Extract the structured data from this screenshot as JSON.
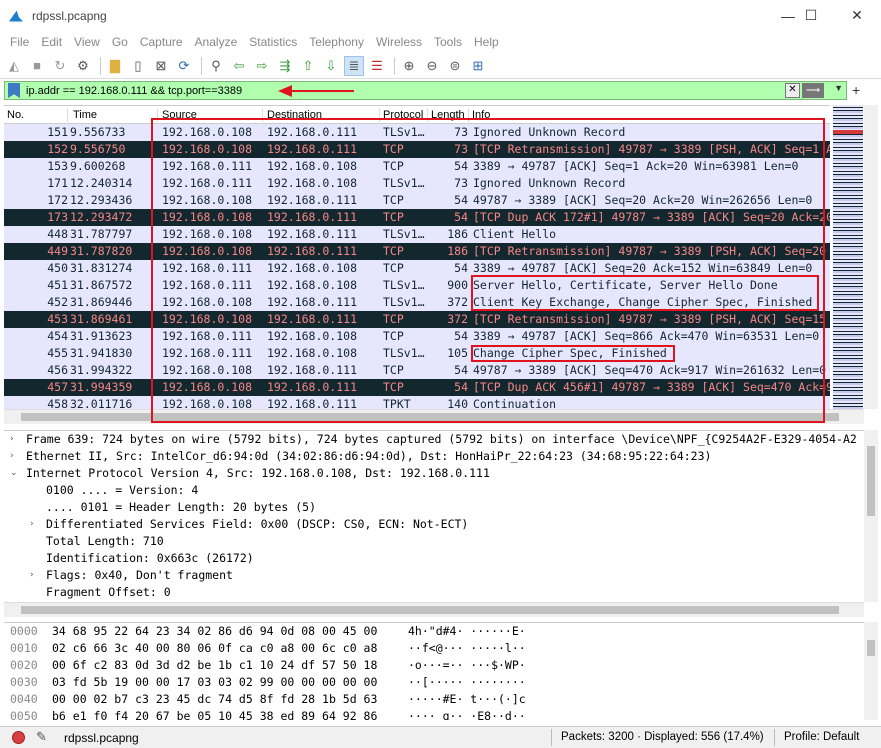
{
  "window": {
    "title": "rdpssl.pcapng",
    "minimize": "—",
    "maximize": "☐",
    "close": "✕"
  },
  "menu": [
    "File",
    "Edit",
    "View",
    "Go",
    "Capture",
    "Analyze",
    "Statistics",
    "Telephony",
    "Wireless",
    "Tools",
    "Help"
  ],
  "filter": {
    "value": "ip.addr == 192.168.0.111 && tcp.port==3389",
    "clear": "✕",
    "apply": "⟶",
    "dropdown": "▼",
    "add": "+"
  },
  "columns": {
    "no": "No.",
    "time": "Time",
    "source": "Source",
    "destination": "Destination",
    "protocol": "Protocol",
    "length": "Length",
    "info": "Info"
  },
  "packets": [
    {
      "no": "151",
      "time": "9.556733",
      "src": "192.168.0.108",
      "dst": "192.168.0.111",
      "proto": "TLSv1…",
      "len": "73",
      "info": "Ignored Unknown Record",
      "style": "normal"
    },
    {
      "no": "152",
      "time": "9.556750",
      "src": "192.168.0.108",
      "dst": "192.168.0.111",
      "proto": "TCP",
      "len": "73",
      "info": "[TCP Retransmission] 49787 → 3389 [PSH, ACK] Seq=1 A",
      "style": "bad"
    },
    {
      "no": "153",
      "time": "9.600268",
      "src": "192.168.0.111",
      "dst": "192.168.0.108",
      "proto": "TCP",
      "len": "54",
      "info": "3389 → 49787 [ACK] Seq=1 Ack=20 Win=63981 Len=0",
      "style": "normal"
    },
    {
      "no": "171",
      "time": "12.240314",
      "src": "192.168.0.111",
      "dst": "192.168.0.108",
      "proto": "TLSv1…",
      "len": "73",
      "info": "Ignored Unknown Record",
      "style": "normal"
    },
    {
      "no": "172",
      "time": "12.293436",
      "src": "192.168.0.108",
      "dst": "192.168.0.111",
      "proto": "TCP",
      "len": "54",
      "info": "49787 → 3389 [ACK] Seq=20 Ack=20 Win=262656 Len=0",
      "style": "normal"
    },
    {
      "no": "173",
      "time": "12.293472",
      "src": "192.168.0.108",
      "dst": "192.168.0.111",
      "proto": "TCP",
      "len": "54",
      "info": "[TCP Dup ACK 172#1] 49787 → 3389 [ACK] Seq=20 Ack=20",
      "style": "bad"
    },
    {
      "no": "448",
      "time": "31.787797",
      "src": "192.168.0.108",
      "dst": "192.168.0.111",
      "proto": "TLSv1…",
      "len": "186",
      "info": "Client Hello",
      "style": "normal"
    },
    {
      "no": "449",
      "time": "31.787820",
      "src": "192.168.0.108",
      "dst": "192.168.0.111",
      "proto": "TCP",
      "len": "186",
      "info": "[TCP Retransmission] 49787 → 3389 [PSH, ACK] Seq=20",
      "style": "bad"
    },
    {
      "no": "450",
      "time": "31.831274",
      "src": "192.168.0.111",
      "dst": "192.168.0.108",
      "proto": "TCP",
      "len": "54",
      "info": "3389 → 49787 [ACK] Seq=20 Ack=152 Win=63849 Len=0",
      "style": "normal"
    },
    {
      "no": "451",
      "time": "31.867572",
      "src": "192.168.0.111",
      "dst": "192.168.0.108",
      "proto": "TLSv1…",
      "len": "900",
      "info": "Server Hello, Certificate, Server Hello Done",
      "style": "normal"
    },
    {
      "no": "452",
      "time": "31.869446",
      "src": "192.168.0.108",
      "dst": "192.168.0.111",
      "proto": "TLSv1…",
      "len": "372",
      "info": "Client Key Exchange, Change Cipher Spec, Finished",
      "style": "normal"
    },
    {
      "no": "453",
      "time": "31.869461",
      "src": "192.168.0.108",
      "dst": "192.168.0.111",
      "proto": "TCP",
      "len": "372",
      "info": "[TCP Retransmission] 49787 → 3389 [PSH, ACK] Seq=15",
      "style": "bad"
    },
    {
      "no": "454",
      "time": "31.913623",
      "src": "192.168.0.111",
      "dst": "192.168.0.108",
      "proto": "TCP",
      "len": "54",
      "info": "3389 → 49787 [ACK] Seq=866 Ack=470 Win=63531 Len=0",
      "style": "normal"
    },
    {
      "no": "455",
      "time": "31.941830",
      "src": "192.168.0.111",
      "dst": "192.168.0.108",
      "proto": "TLSv1…",
      "len": "105",
      "info": "Change Cipher Spec, Finished",
      "style": "normal"
    },
    {
      "no": "456",
      "time": "31.994322",
      "src": "192.168.0.108",
      "dst": "192.168.0.111",
      "proto": "TCP",
      "len": "54",
      "info": "49787 → 3389 [ACK] Seq=470 Ack=917 Win=261632 Len=0",
      "style": "normal"
    },
    {
      "no": "457",
      "time": "31.994359",
      "src": "192.168.0.108",
      "dst": "192.168.0.111",
      "proto": "TCP",
      "len": "54",
      "info": "[TCP Dup ACK 456#1] 49787 → 3389 [ACK] Seq=470 Ack=9",
      "style": "bad"
    },
    {
      "no": "458",
      "time": "32.011716",
      "src": "192.168.0.108",
      "dst": "192.168.0.111",
      "proto": "TPKT",
      "len": "140",
      "info": "Continuation",
      "style": "normal"
    }
  ],
  "details": [
    {
      "twisty": "›",
      "indent": 0,
      "text": "Frame 639: 724 bytes on wire (5792 bits), 724 bytes captured (5792 bits) on interface \\Device\\NPF_{C9254A2F-E329-4054-A2"
    },
    {
      "twisty": "›",
      "indent": 0,
      "text": "Ethernet II, Src: IntelCor_d6:94:0d (34:02:86:d6:94:0d), Dst: HonHaiPr_22:64:23 (34:68:95:22:64:23)"
    },
    {
      "twisty": "⌄",
      "indent": 0,
      "text": "Internet Protocol Version 4, Src: 192.168.0.108, Dst: 192.168.0.111"
    },
    {
      "twisty": "",
      "indent": 1,
      "text": "0100 .... = Version: 4"
    },
    {
      "twisty": "",
      "indent": 1,
      "text": ".... 0101 = Header Length: 20 bytes (5)"
    },
    {
      "twisty": "›",
      "indent": 1,
      "text": "Differentiated Services Field: 0x00 (DSCP: CS0, ECN: Not-ECT)"
    },
    {
      "twisty": "",
      "indent": 1,
      "text": "Total Length: 710"
    },
    {
      "twisty": "",
      "indent": 1,
      "text": "Identification: 0x663c (26172)"
    },
    {
      "twisty": "›",
      "indent": 1,
      "text": "Flags: 0x40, Don't fragment"
    },
    {
      "twisty": "",
      "indent": 1,
      "text": "Fragment Offset: 0"
    }
  ],
  "bytes": [
    {
      "offset": "0000",
      "hex": "34 68 95 22 64 23 34 02  86 d6 94 0d 08 00 45 00",
      "ascii": "4h·\"d#4·  ······E·"
    },
    {
      "offset": "0010",
      "hex": "02 c6 66 3c 40 00 80 06  0f ca c0 a8 00 6c c0 a8",
      "ascii": "··f<@···  ·····l··"
    },
    {
      "offset": "0020",
      "hex": "00 6f c2 83 0d 3d d2 be  1b c1 10 24 df 57 50 18",
      "ascii": "·o···=··  ···$·WP·"
    },
    {
      "offset": "0030",
      "hex": "03 fd 5b 19 00 00 17 03  03 02 99 00 00 00 00 00",
      "ascii": "··[·····  ········"
    },
    {
      "offset": "0040",
      "hex": "00 00 02 b7 c3 23 45 dc  74 d5 8f fd 28 1b 5d 63",
      "ascii": "·····#E·  t···(·]c"
    },
    {
      "offset": "0050",
      "hex": "b6 e1 f0 f4 20 67 be 05  10 45 38 ed 89 64 92 86",
      "ascii": "···· g··  ·E8··d··"
    }
  ],
  "status": {
    "file": "rdpssl.pcapng",
    "packets": "Packets: 3200 · Displayed: 556 (17.4%)",
    "profile": "Profile: Default"
  },
  "colors": {
    "normal_bg": "#e7e6ff",
    "normal_fg": "#12272e",
    "bad_bg": "#12272e",
    "bad_fg": "#f78787",
    "filter_bg": "#afffaf",
    "highlight": "#e0141e"
  },
  "icons": [
    "shark-fin-start",
    "stop-square",
    "shark-fin-restart",
    "gear-options",
    "open-folder",
    "file",
    "close-file",
    "reload",
    "search",
    "arrow-back",
    "arrow-forward",
    "jump",
    "arrow-up",
    "arrow-down",
    "autoscroll",
    "colorize",
    "zoom-in",
    "zoom-out",
    "zoom-reset",
    "resize-columns"
  ]
}
